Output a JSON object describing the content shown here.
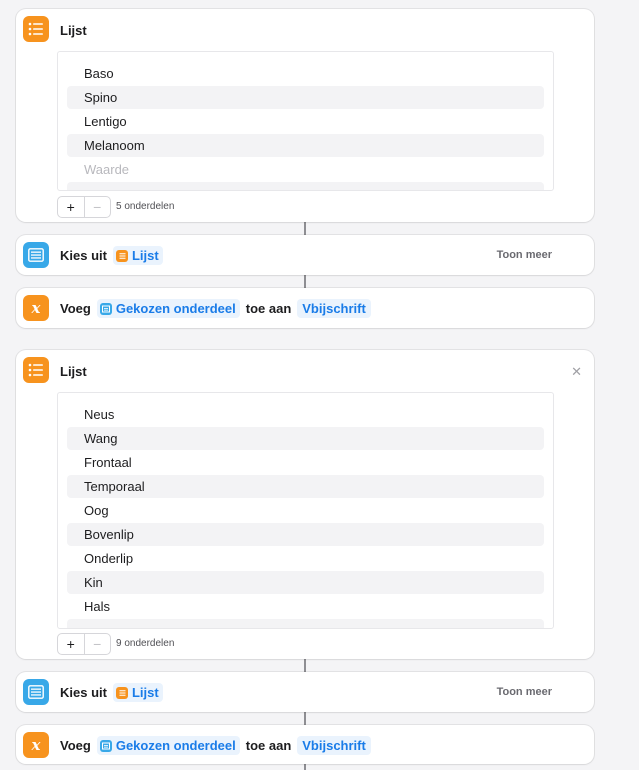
{
  "list1": {
    "title": "Lijst",
    "items": [
      "Baso",
      "Spino",
      "Lentigo",
      "Melanoom"
    ],
    "placeholder": "Waarde",
    "count": "5 onderdelen",
    "add": "+",
    "remove": "−"
  },
  "choose1": {
    "label": "Kies uit",
    "token": "Lijst",
    "show_more": "Toon meer"
  },
  "add1": {
    "label": "Voeg",
    "token": "Gekozen onderdeel",
    "middle": "toe aan",
    "variable": "Vbijschrift"
  },
  "list2": {
    "title": "Lijst",
    "close": "✕",
    "items": [
      "Neus",
      "Wang",
      "Frontaal",
      "Temporaal",
      "Oog",
      "Bovenlip",
      "Onderlip",
      "Kin",
      "Hals"
    ],
    "count": "9 onderdelen",
    "add": "+",
    "remove": "−"
  },
  "choose2": {
    "label": "Kies uit",
    "token": "Lijst",
    "show_more": "Toon meer"
  },
  "add2": {
    "label": "Voeg",
    "token": "Gekozen onderdeel",
    "middle": "toe aan",
    "variable": "Vbijschrift"
  },
  "colors": {
    "accent_orange": "#f7931e",
    "accent_blue": "#38a8e8",
    "token_text": "#1a7ce8"
  }
}
